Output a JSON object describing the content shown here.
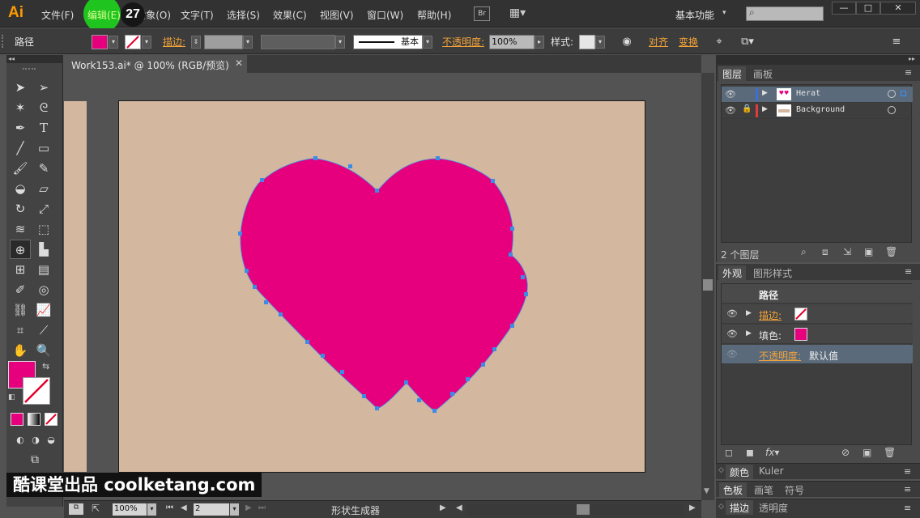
{
  "app": {
    "logo": "Ai",
    "menus": [
      "文件(F)",
      "编辑(E)",
      "对象(O)",
      "文字(T)",
      "选择(S)",
      "效果(C)",
      "视图(V)",
      "窗口(W)",
      "帮助(H)"
    ],
    "overlay_step": "27",
    "bridge_label": "Br",
    "workspace": "基本功能",
    "window_buttons": [
      "—",
      "□",
      "✕"
    ]
  },
  "control_bar": {
    "object_type": "路径",
    "stroke_label": "描边:",
    "stroke_style": "基本",
    "opacity_label": "不透明度:",
    "opacity_value": "100%",
    "style_label": "样式:",
    "align_label": "对齐",
    "transform_label": "变换",
    "fill_color": "#e6007e"
  },
  "document": {
    "tab_title": "Work153.ai* @ 100% (RGB/预览)",
    "artboard_color": "#d3b79f",
    "heart_color": "#e6007e",
    "anchor_color": "#3c8ce6"
  },
  "status_bar": {
    "zoom": "100%",
    "page": "2",
    "tool_name": "形状生成器"
  },
  "layers_panel": {
    "tabs": [
      "图层",
      "画板"
    ],
    "layers": [
      {
        "name": "Herat",
        "color": "#3d6fd6",
        "selected": true
      },
      {
        "name": "Background",
        "color": "#e03c3c",
        "selected": false
      }
    ],
    "count_label": "2 个图层"
  },
  "appearance_panel": {
    "tabs": [
      "外观",
      "图形样式"
    ],
    "header": "路径",
    "rows": [
      {
        "label": "描边:",
        "kind": "stroke"
      },
      {
        "label": "填色:",
        "kind": "fill"
      }
    ],
    "opacity_label": "不透明度:",
    "opacity_value": "默认值"
  },
  "mini_panels": {
    "color": [
      "颜色",
      "Kuler"
    ],
    "brush": [
      "色板",
      "画笔",
      "符号"
    ],
    "stroke": [
      "描边",
      "透明度"
    ]
  },
  "watermark": "酷课堂出品 coolketang.com"
}
